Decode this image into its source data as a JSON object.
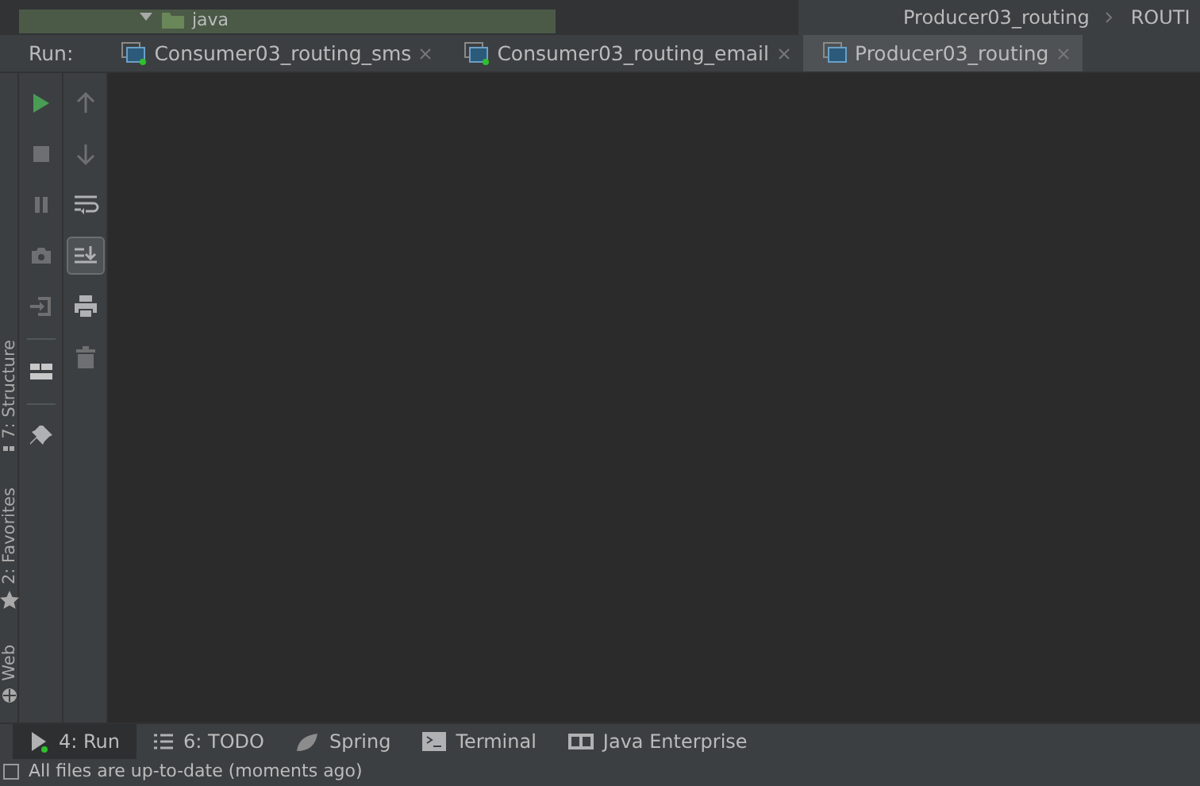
{
  "project_tree": {
    "node": "java",
    "highlighted": true
  },
  "breadcrumb": [
    "Producer03_routing",
    "ROUTI"
  ],
  "run_panel": {
    "label": "Run:",
    "tabs": [
      {
        "label": "Consumer03_routing_sms",
        "selected": false
      },
      {
        "label": "Consumer03_routing_email",
        "selected": false
      },
      {
        "label": "Producer03_routing",
        "selected": true
      }
    ],
    "toolbar_left": [
      {
        "kind": "run",
        "disabled": false
      },
      {
        "kind": "stop",
        "disabled": true
      },
      {
        "kind": "pause",
        "disabled": true
      },
      {
        "kind": "camera",
        "disabled": true
      },
      {
        "kind": "login",
        "disabled": true
      },
      {
        "kind": "sep"
      },
      {
        "kind": "layout",
        "disabled": false
      },
      {
        "kind": "sep"
      },
      {
        "kind": "pin",
        "disabled": false
      }
    ],
    "toolbar_right": [
      {
        "kind": "up",
        "disabled": true,
        "on": false
      },
      {
        "kind": "down",
        "disabled": true,
        "on": false
      },
      {
        "kind": "wrap",
        "disabled": false,
        "on": false
      },
      {
        "kind": "scroll",
        "disabled": false,
        "on": true
      },
      {
        "kind": "print",
        "disabled": false,
        "on": false
      },
      {
        "kind": "trash",
        "disabled": true,
        "on": false
      }
    ]
  },
  "side_stripe": [
    {
      "kind": "structure",
      "label": "7: Structure"
    },
    {
      "kind": "favorites",
      "label": "2: Favorites"
    },
    {
      "kind": "web",
      "label": "Web"
    }
  ],
  "bottom_tabs": [
    {
      "kind": "run",
      "label": "4: Run",
      "selected": true
    },
    {
      "kind": "todo",
      "label": "6: TODO",
      "selected": false
    },
    {
      "kind": "spring",
      "label": "Spring",
      "selected": false
    },
    {
      "kind": "terminal",
      "label": "Terminal",
      "selected": false
    },
    {
      "kind": "javaee",
      "label": "Java Enterprise",
      "selected": false
    }
  ],
  "status_bar": "All files are up-to-date (moments ago)"
}
